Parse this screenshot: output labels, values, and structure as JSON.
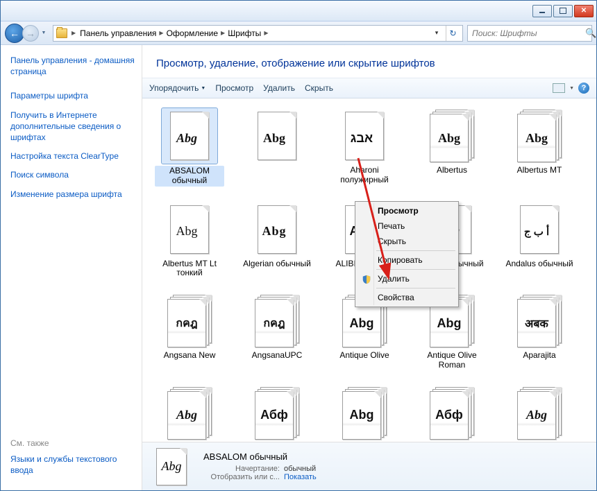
{
  "titlebar": {},
  "breadcrumbs": [
    "Панель управления",
    "Оформление",
    "Шрифты"
  ],
  "search": {
    "placeholder": "Поиск: Шрифты"
  },
  "sidebar": {
    "home": "Панель управления - домашняя страница",
    "links": [
      "Параметры шрифта",
      "Получить в Интернете дополнительные сведения о шрифтах",
      "Настройка текста ClearType",
      "Поиск символа",
      "Изменение размера шрифта"
    ],
    "also_label": "См. также",
    "also_link": "Языки и службы текстового ввода"
  },
  "main_title": "Просмотр, удаление, отображение или скрытие шрифтов",
  "toolbar": {
    "organize": "Упорядочить",
    "preview": "Просмотр",
    "delete": "Удалить",
    "hide": "Скрыть"
  },
  "context_menu": {
    "preview": "Просмотр",
    "print": "Печать",
    "hide": "Скрыть",
    "copy": "Копировать",
    "delete": "Удалить",
    "properties": "Свойства"
  },
  "fonts": [
    {
      "name": "ABSALOM обычный",
      "sample": "Abg",
      "style": "italic script",
      "single": true
    },
    {
      "name": "",
      "sample": "Abg",
      "style": "serif",
      "single": true
    },
    {
      "name": "Aharoni полужирный",
      "sample": "אבג",
      "style": "bold",
      "single": true
    },
    {
      "name": "Albertus",
      "sample": "Abg",
      "style": "serif"
    },
    {
      "name": "Albertus MT",
      "sample": "Abg",
      "style": "serif"
    },
    {
      "name": "Albertus MT Lt тонкий",
      "sample": "Abg",
      "style": "light",
      "single": true
    },
    {
      "name": "Algerian обычный",
      "sample": "Abg",
      "style": "deco",
      "single": true
    },
    {
      "name": "ALIBI обычный",
      "sample": "Abg",
      "style": "black",
      "single": true
    },
    {
      "name": "Amaze обычный",
      "sample": "Abg",
      "style": "script",
      "single": true
    },
    {
      "name": "Andalus обычный",
      "sample": "أ ب ج",
      "style": "arabic",
      "single": true
    },
    {
      "name": "Angsana New",
      "sample": "กคฎ",
      "style": "thai"
    },
    {
      "name": "AngsanaUPC",
      "sample": "กคฎ",
      "style": "thai"
    },
    {
      "name": "Antique Olive",
      "sample": "Abg",
      "style": "sansblack"
    },
    {
      "name": "Antique Olive Roman",
      "sample": "Abg",
      "style": "sans"
    },
    {
      "name": "Aparajita",
      "sample": "अबक",
      "style": "deva"
    },
    {
      "name": "",
      "sample": "Abg",
      "style": "scriptit"
    },
    {
      "name": "",
      "sample": "Абф",
      "style": "sans"
    },
    {
      "name": "",
      "sample": "Abg",
      "style": "sansblack"
    },
    {
      "name": "",
      "sample": "Абф",
      "style": "sans"
    },
    {
      "name": "",
      "sample": "Abg",
      "style": "brush"
    }
  ],
  "details": {
    "name": "ABSALOM обычный",
    "style_label": "Начертание:",
    "style_value": "обычный",
    "show_label": "Отобразить или с...",
    "show_value": "Показать",
    "sample": "Abg"
  }
}
